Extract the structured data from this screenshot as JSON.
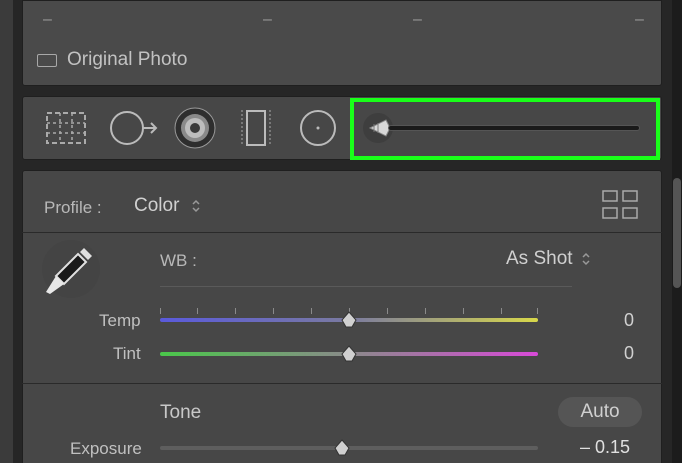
{
  "top_panel": {
    "dash_glyph": "–",
    "original_photo_label": "Original Photo"
  },
  "tools": {
    "icons": [
      "crop-overlay-icon",
      "spot-removal-icon",
      "red-eye-icon",
      "graduated-filter-icon",
      "radial-filter-icon",
      "brush-size-icon"
    ]
  },
  "basic": {
    "profile_label": "Profile :",
    "profile_value": "Color",
    "wb_label": "WB :",
    "wb_value": "As Shot",
    "temp_label": "Temp",
    "temp_value": "0",
    "tint_label": "Tint",
    "tint_value": "0",
    "tone_label": "Tone",
    "auto_label": "Auto",
    "exposure_label": "Exposure",
    "exposure_value": "– 0.15"
  },
  "colors": {
    "highlight": "#19ff19",
    "temp_gradient": [
      "#5a5adc",
      "#d8d84a"
    ],
    "tint_gradient": [
      "#4ac84a",
      "#d84ad8"
    ]
  }
}
